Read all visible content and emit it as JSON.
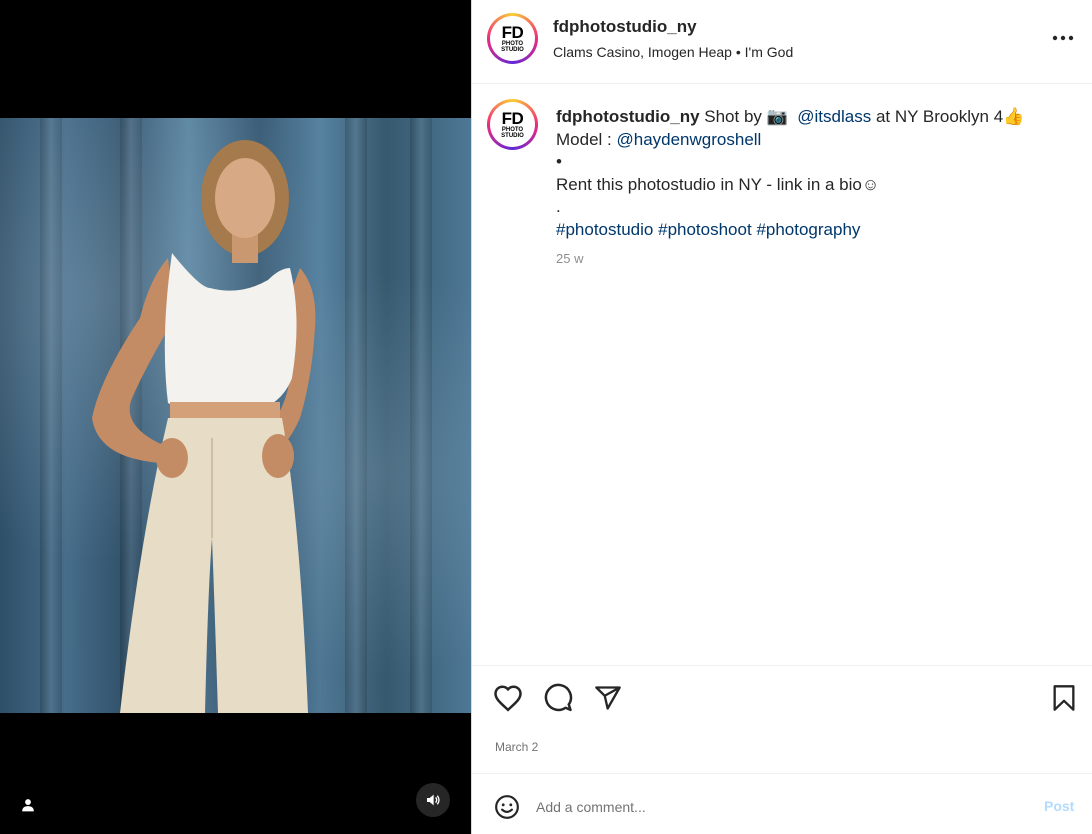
{
  "post": {
    "username": "fdphotostudio_ny",
    "audio": "Clams Casino, Imogen Heap • I'm God",
    "avatar": {
      "logo_text": "FD",
      "logo_sub": "PHOTO STUDIO",
      "ring_colors": [
        "#f9ce34",
        "#ee2a7b",
        "#6228d7"
      ]
    },
    "more_icon": "more-horizontal-icon"
  },
  "caption": {
    "username": "fdphotostudio_ny",
    "line1_a": " Shot by ",
    "camera_emoji": "📷",
    "mention1": "@itsdlass",
    "line1_b": " at NY Brooklyn 4👍",
    "line2_label": "Model : ",
    "mention2": "@haydenwgroshell",
    "line3": "•",
    "line4": "Rent this photostudio in NY - link in a bio☺",
    "line5": ".",
    "hashtags": [
      "#photostudio",
      "#photoshoot",
      "#photography"
    ],
    "time": "25 w"
  },
  "actions": {
    "like_icon": "heart-icon",
    "comment_icon": "comment-icon",
    "share_icon": "paper-plane-icon",
    "save_icon": "bookmark-icon",
    "date": "March 2"
  },
  "comment_box": {
    "emoji_icon": "smiley-icon",
    "placeholder": "Add a comment...",
    "post_label": "Post"
  },
  "media": {
    "user_tag_icon": "user-icon",
    "sound_icon": "speaker-icon",
    "background_color": "#000000",
    "backdrop_color": "#466d8a"
  },
  "colors": {
    "link": "#00376b",
    "secondary_text": "#737373",
    "post_disabled": "#b3dbff"
  }
}
